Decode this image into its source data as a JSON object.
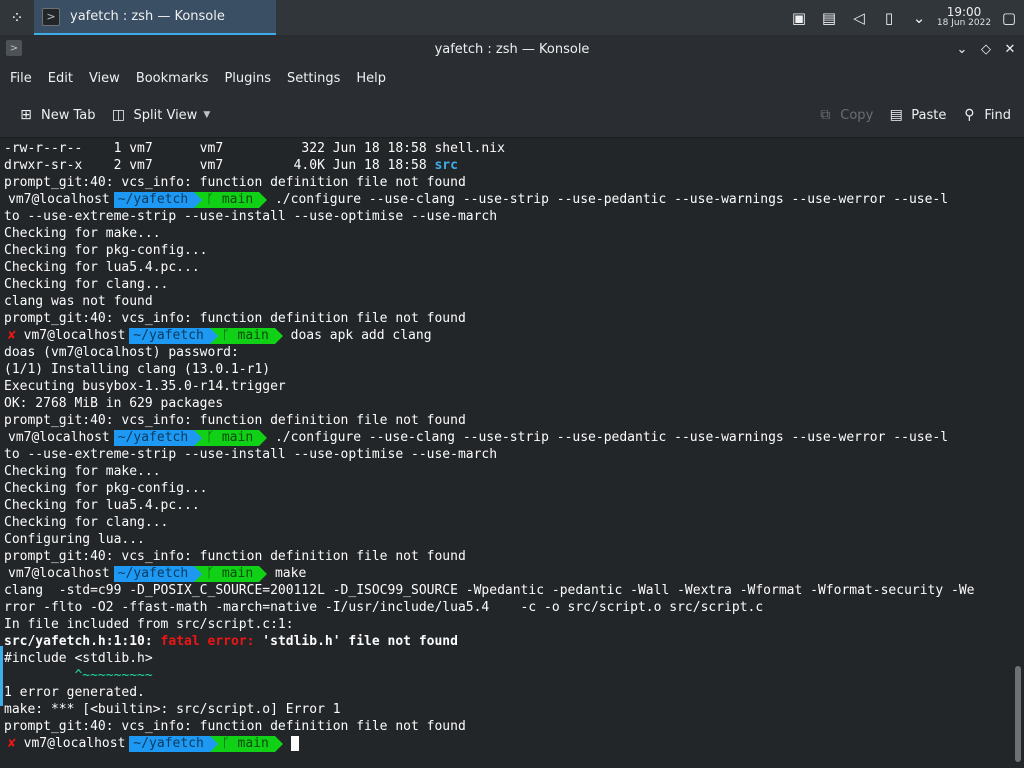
{
  "panel": {
    "task_label": "yafetch : zsh — Konsole",
    "clock_time": "19:00",
    "clock_date": "18 Jun 2022",
    "tray_icons": [
      "screen-icon",
      "clipboard-icon",
      "volume-muted-icon",
      "battery-icon",
      "chevron-down-icon",
      "show-desktop-icon"
    ]
  },
  "window": {
    "title": "yafetch : zsh — Konsole"
  },
  "menu": [
    "File",
    "Edit",
    "View",
    "Bookmarks",
    "Plugins",
    "Settings",
    "Help"
  ],
  "toolbar": {
    "new_tab": "New Tab",
    "split_view": "Split View",
    "copy": "Copy",
    "paste": "Paste",
    "find": "Find"
  },
  "prompt": {
    "user": "vm7@localhost",
    "dir": "~/yafetch",
    "branch": "main",
    "git_glyph": "ᚴ",
    "fail_glyph": "✘"
  },
  "terminal": {
    "l1": "-rw-r--r--    1 vm7      vm7          322 Jun 18 18:58 shell.nix",
    "l2a": "drwxr-sr-x    2 vm7      vm7         4.0K Jun 18 18:58 ",
    "l2b": "src",
    "vcs": "prompt_git:40: vcs_info: function definition file not found",
    "cmd_configure_1": "./configure --use-clang --use-strip --use-pedantic --use-warnings --use-werror --use-l",
    "cmd_configure_2": "to --use-extreme-strip --use-install --use-optimise --use-march",
    "chk_make": "Checking for make...",
    "chk_pkg": "Checking for pkg-config...",
    "chk_lua": "Checking for lua5.4.pc...",
    "chk_clang": "Checking for clang...",
    "clang_missing": "clang was not found",
    "cmd_apk": "doas apk add clang",
    "doas_pw": "doas (vm7@localhost) password:",
    "installing": "(1/1) Installing clang (13.0.1-r1)",
    "executing": "Executing busybox-1.35.0-r14.trigger",
    "ok": "OK: 2768 MiB in 629 packages",
    "cfg_lua": "Configuring lua...",
    "cmd_make": "make",
    "clang_line1": "clang  -std=c99 -D_POSIX_C_SOURCE=200112L -D_ISOC99_SOURCE -Wpedantic -pedantic -Wall -Wextra -Wformat -Wformat-security -We",
    "clang_line2": "rror -flto -O2 -ffast-math -march=native -I/usr/include/lua5.4    -c -o src/script.o src/script.c",
    "included_from": "In file included from src/script.c:1:",
    "err_loc": "src/yafetch.h:1:10: ",
    "err_fatal": "fatal error: ",
    "err_msg": "'stdlib.h' file not found",
    "include_line": "#include <stdlib.h>",
    "caret_line": "         ^~~~~~~~~~",
    "errors_generated": "1 error generated.",
    "make_err": "make: *** [<builtin>: src/script.o] Error 1"
  }
}
